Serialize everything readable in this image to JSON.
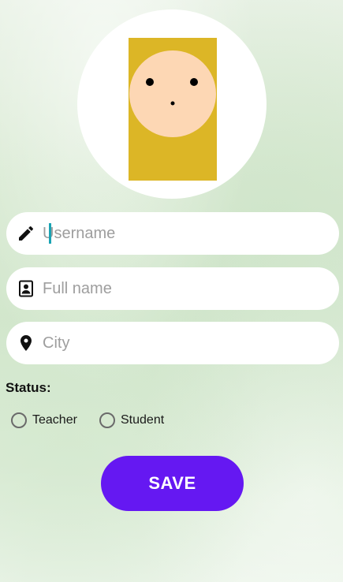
{
  "avatar": {
    "icon": "avatar-face-icon",
    "colors": {
      "background": "#dcb626",
      "face": "#fdd7b4",
      "features": "#000000"
    }
  },
  "form": {
    "username": {
      "placeholder": "Username",
      "value": "",
      "icon": "pencil-icon"
    },
    "fullname": {
      "placeholder": "Full name",
      "value": "",
      "icon": "contact-card-icon"
    },
    "city": {
      "placeholder": "City",
      "value": "",
      "icon": "location-pin-icon"
    }
  },
  "status": {
    "label": "Status:",
    "options": [
      {
        "label": "Teacher",
        "selected": false
      },
      {
        "label": "Student",
        "selected": false
      }
    ]
  },
  "actions": {
    "save_label": "SAVE",
    "save_color": "#6518f2"
  }
}
